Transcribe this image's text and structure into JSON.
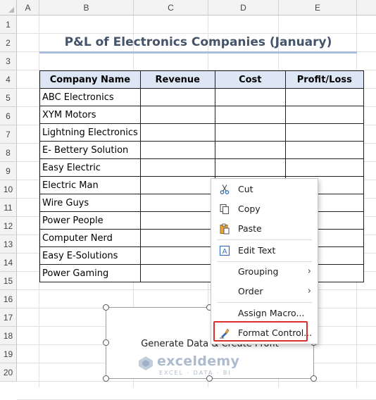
{
  "sheet": {
    "columns": [
      "A",
      "B",
      "C",
      "D",
      "E"
    ],
    "rows": [
      "1",
      "2",
      "3",
      "4",
      "5",
      "6",
      "7",
      "8",
      "9",
      "10",
      "11",
      "12",
      "13",
      "14",
      "15",
      "16",
      "17",
      "18",
      "19",
      "20"
    ]
  },
  "title": "P&L of Electronics Companies (January)",
  "table": {
    "headers": [
      "Company Name",
      "Revenue",
      "Cost",
      "Profit/Loss"
    ],
    "companies": [
      "ABC Electronics",
      "XYM Motors",
      "Lightning Electronics",
      "E- Bettery Solution",
      "Easy Electric",
      "Electric Man",
      "Wire Guys",
      "Power People",
      "Computer Nerd",
      "Easy E-Solutions",
      "Power Gaming"
    ]
  },
  "button_control": {
    "label": "Generate Data & Create Profit"
  },
  "context_menu": {
    "items": [
      {
        "label": "Cut",
        "icon": "scissors-icon"
      },
      {
        "label": "Copy",
        "icon": "copy-icon"
      },
      {
        "label": "Paste",
        "icon": "paste-icon"
      },
      {
        "label": "Edit Text",
        "icon": "edit-text-icon"
      },
      {
        "label": "Grouping",
        "submenu": true
      },
      {
        "label": "Order",
        "submenu": true
      },
      {
        "label": "Assign Macro..."
      },
      {
        "label": "Format Control...",
        "icon": "format-control-icon",
        "highlighted": true
      }
    ]
  },
  "watermark": {
    "brand": "exceldemy",
    "tagline": "EXCEL · DATA · BI"
  },
  "colors": {
    "header_fill": "#dde6f4",
    "title_text": "#44546a",
    "title_underline": "#a9bcdc",
    "highlight_border": "#d9302c"
  }
}
